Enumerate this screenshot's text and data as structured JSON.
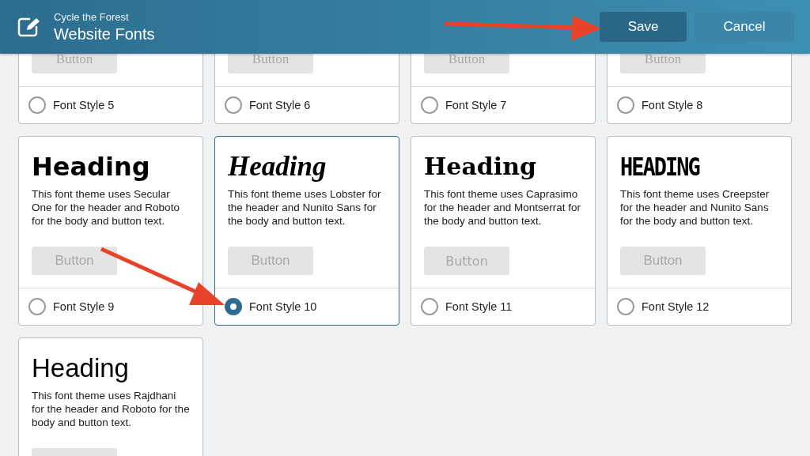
{
  "header": {
    "subtitle": "Cycle the Forest",
    "title": "Website Fonts",
    "buttons": [
      {
        "label": "Save",
        "kind": "primary"
      },
      {
        "label": "Cancel",
        "kind": "secondary"
      }
    ]
  },
  "cards": [
    {
      "kind": "serif",
      "button": "Button",
      "name": "Font Style 5",
      "selected": false
    },
    {
      "kind": "serif",
      "button": "Button",
      "name": "Font Style 6",
      "selected": false
    },
    {
      "kind": "serif",
      "button": "Button",
      "name": "Font Style 7",
      "selected": false
    },
    {
      "kind": "serif",
      "button": "Button",
      "name": "Font Style 8",
      "selected": false
    },
    {
      "kind": "bold",
      "heading": "Heading",
      "description": "This font theme uses Secular One for the header and Roboto for the body and button text.",
      "button": "Button",
      "name": "Font Style 9",
      "selected": false
    },
    {
      "kind": "script",
      "heading": "Heading",
      "description": "This font theme uses Lobster for the header and Nunito Sans for the body and button text.",
      "button": "Button",
      "name": "Font Style 10",
      "selected": true
    },
    {
      "kind": "slab",
      "heading": "Heading",
      "description": "This font theme uses Caprasimo for the header and Montserrat for the body and button text.",
      "button": "Button",
      "name": "Font Style 11",
      "selected": false
    },
    {
      "kind": "creepy",
      "heading": "HEADING",
      "description": "This font theme uses Creepster for the header and Nunito Sans for the body and button text.",
      "button": "Button",
      "name": "Font Style 12",
      "selected": false
    },
    {
      "kind": "narrow",
      "heading": "Heading",
      "description": "This font theme uses Rajdhani for the header and Roboto for the body and button text."
    }
  ]
}
